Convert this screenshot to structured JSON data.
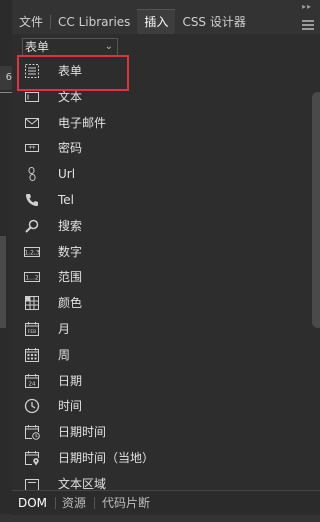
{
  "tabs": [
    {
      "label": "文件"
    },
    {
      "label": "CC Libraries"
    },
    {
      "label": "插入"
    },
    {
      "label": "CSS 设计器"
    }
  ],
  "active_tab": "插入",
  "left_panel": {
    "hint": "6"
  },
  "category_select": {
    "value": "表单"
  },
  "items": [
    {
      "label": "表单",
      "icon": "form-icon"
    },
    {
      "label": "文本",
      "icon": "text-field-icon"
    },
    {
      "label": "电子邮件",
      "icon": "email-icon"
    },
    {
      "label": "密码",
      "icon": "password-icon"
    },
    {
      "label": "Url",
      "icon": "url-link-icon"
    },
    {
      "label": "Tel",
      "icon": "phone-icon"
    },
    {
      "label": "搜索",
      "icon": "search-icon"
    },
    {
      "label": "数字",
      "icon": "number-icon"
    },
    {
      "label": "范围",
      "icon": "range-icon"
    },
    {
      "label": "颜色",
      "icon": "color-grid-icon"
    },
    {
      "label": "月",
      "icon": "month-calendar-icon"
    },
    {
      "label": "周",
      "icon": "week-calendar-icon"
    },
    {
      "label": "日期",
      "icon": "date-calendar-icon"
    },
    {
      "label": "时间",
      "icon": "clock-icon"
    },
    {
      "label": "日期时间",
      "icon": "datetime-icon"
    },
    {
      "label": "日期时间（当地）",
      "icon": "datetime-local-icon"
    },
    {
      "label": "文本区域",
      "icon": "textarea-icon"
    }
  ],
  "bottom_tabs": [
    {
      "label": "DOM"
    },
    {
      "label": "资源"
    },
    {
      "label": "代码片断"
    }
  ],
  "colors": {
    "highlight": "#e0323b",
    "panel": "#2d2d2d",
    "background": "#333333"
  }
}
